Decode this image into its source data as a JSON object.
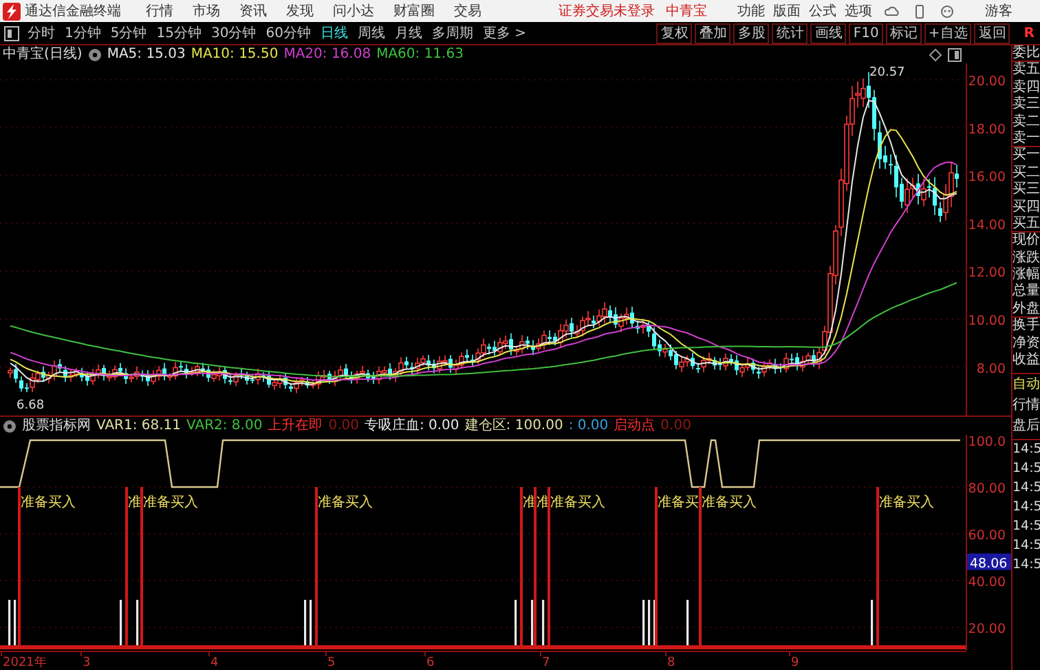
{
  "title_bar": {
    "app_name": "通达信金融终端",
    "menu": [
      "行情",
      "市场",
      "资讯",
      "发现",
      "问小达",
      "财富圈",
      "交易"
    ],
    "login_status": "证券交易未登录",
    "stock": "中青宝",
    "tools": [
      "功能",
      "版面",
      "公式",
      "选项"
    ],
    "user": "游客"
  },
  "toolbar": {
    "periods": [
      {
        "label": "分时",
        "selected": false
      },
      {
        "label": "1分钟",
        "selected": false
      },
      {
        "label": "5分钟",
        "selected": false
      },
      {
        "label": "15分钟",
        "selected": false
      },
      {
        "label": "30分钟",
        "selected": false
      },
      {
        "label": "60分钟",
        "selected": false
      },
      {
        "label": "日线",
        "selected": true
      },
      {
        "label": "周线",
        "selected": false
      },
      {
        "label": "月线",
        "selected": false
      },
      {
        "label": "多周期",
        "selected": false
      }
    ],
    "more": "更多 >",
    "actions": [
      "复权",
      "叠加",
      "多股",
      "统计",
      "画线",
      "F10",
      "标记",
      "+自选",
      "返回"
    ],
    "corner": "R"
  },
  "price_chart": {
    "title": "中青宝(日线)",
    "ma": [
      {
        "label": "MA5: 15.03",
        "color": "#e8e8e8"
      },
      {
        "label": "MA10: 15.50",
        "color": "#e6e650"
      },
      {
        "label": "MA20: 16.08",
        "color": "#d040d0"
      },
      {
        "label": "MA60: 11.63",
        "color": "#40c040"
      }
    ],
    "yticks": [
      "20.00",
      "18.00",
      "16.00",
      "14.00",
      "12.00",
      "10.00",
      "8.00"
    ],
    "annotations": [
      "20.57",
      "6.68"
    ]
  },
  "indicator": {
    "name": "股票指标网",
    "values": [
      {
        "label": "VAR1: 68.11",
        "color": "#e0e0a8"
      },
      {
        "label": "VAR2: 8.00",
        "color": "#40c040"
      },
      {
        "label": "上升在即",
        "color": "#ff3030"
      },
      {
        "label": "0.00",
        "color": "#901818"
      },
      {
        "label": "专吸庄血: 0.00",
        "color": "#e8e8e8"
      },
      {
        "label": "建仓区: 100.00",
        "color": "#e0e0a8"
      },
      {
        "label": ": 0.00",
        "color": "#3aa0e0"
      },
      {
        "label": "启动点",
        "color": "#ff3030"
      },
      {
        "label": "0.00",
        "color": "#901818"
      }
    ],
    "yticks": [
      "100.0",
      "80.00",
      "60.00",
      "40.00",
      "20.00"
    ],
    "current": "48.06",
    "signals": [
      {
        "label": "准备买入"
      },
      {
        "label": "准"
      },
      {
        "label": "准备买入"
      },
      {
        "label": "准备买入"
      },
      {
        "label": "准"
      },
      {
        "label": "准"
      },
      {
        "label": "准备买入"
      },
      {
        "label": "准备买"
      },
      {
        "label": "准备买入"
      },
      {
        "label": "准备买入"
      }
    ]
  },
  "dates": [
    "2021年",
    "3",
    "4",
    "5",
    "6",
    "7",
    "8",
    "9"
  ],
  "side_panel": {
    "quote_labels": [
      "委比",
      "卖五",
      "卖四",
      "卖三",
      "卖二",
      "卖一",
      "买一",
      "买二",
      "买三",
      "买四",
      "买五",
      "现价",
      "涨跌",
      "涨幅",
      "总量",
      "外盘",
      "换手",
      "净资",
      "收益"
    ],
    "sections": [
      {
        "label": "自动",
        "selected": true
      },
      {
        "label": "行情",
        "selected": false
      },
      {
        "label": "盘后",
        "selected": false
      }
    ],
    "times": [
      "14:5",
      "14:5",
      "14:5",
      "14:5",
      "14:5",
      "14:5",
      "14:5"
    ]
  }
}
